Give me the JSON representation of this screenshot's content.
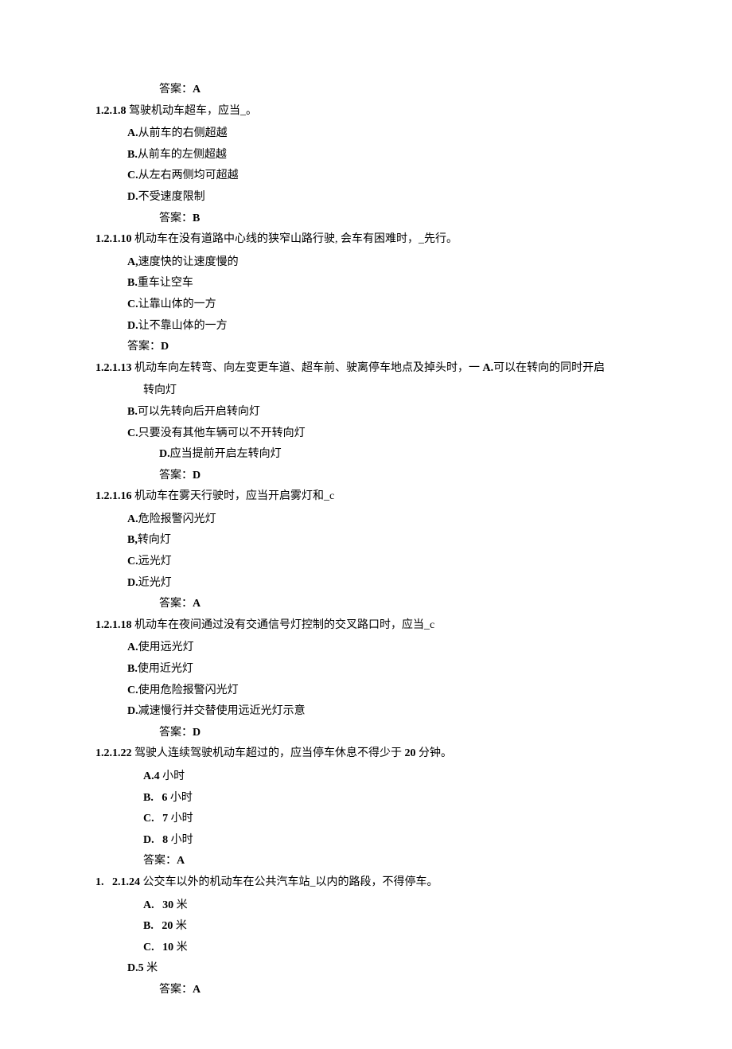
{
  "q0": {
    "answer_label": "答案：",
    "answer": "A"
  },
  "q1": {
    "number": "1.2.1.8",
    "text": " 驾驶机动车超车，应当_。",
    "opts": {
      "A": "从前车的右侧超越",
      "B": "从前车的左侧超越",
      "C": "从左右两侧均可超越",
      "D": "不受速度限制"
    },
    "answer_label": "答案：",
    "answer": "B"
  },
  "q2": {
    "number": "1.2.1.10",
    "text": " 机动车在没有道路中心线的狭窄山路行驶, 会车有困难时，_先行。",
    "opts": {
      "A": "速度快的让速度慢的",
      "B": "重车让空车",
      "C": "让靠山体的一方",
      "D": "让不靠山体的一方"
    },
    "answer_label": "答案：",
    "answer": "D"
  },
  "q3": {
    "number": "1.2.1.13",
    "text": " 机动车向左转弯、向左变更车道、超车前、驶离停车地点及掉头时，一 ",
    "optA_inline": "可以在转向的同时开启",
    "cont": "转向灯",
    "opts": {
      "B": "可以先转向后开启转向灯",
      "C": "只要没有其他车辆可以不开转向灯",
      "D": "应当提前开启左转向灯"
    },
    "answer_label": "答案：",
    "answer": "D"
  },
  "q4": {
    "number": "1.2.1.16",
    "text": " 机动车在雾天行驶时，应当开启雾灯和_c",
    "opts": {
      "A": "危险报警闪光灯",
      "B": "转向灯",
      "C": "远光灯",
      "D": "近光灯"
    },
    "answer_label": "答案：",
    "answer": "A"
  },
  "q5": {
    "number": "1.2.1.18",
    "text": " 机动车在夜间通过没有交通信号灯控制的交叉路口时，应当_c",
    "opts": {
      "A": "使用远光灯",
      "B": "使用近光灯",
      "C": "使用危险报警闪光灯",
      "D": "减速慢行并交替使用远近光灯示意"
    },
    "answer_label": "答案：",
    "answer": "D"
  },
  "q6": {
    "number": "1.2.1.22",
    "text": " 驾驶人连续驾驶机动车超过的，应当停车休息不得少于 ",
    "tail": " 分钟。",
    "tail_num": "20",
    "opts": {
      "A": "4",
      "A_suffix": " 小时",
      "B": "6",
      "B_suffix": " 小时",
      "C": "7",
      "C_suffix": " 小时",
      "D": "8",
      "D_suffix": " 小时"
    },
    "answer_label": "答案：",
    "answer": "A"
  },
  "q7": {
    "number_prefix": "1.",
    "number": "2.1.24",
    "text": " 公交车以外的机动车在公共汽车站_以内的路段，不得停车。",
    "opts": {
      "A": "30",
      "A_suffix": " 米",
      "B": "20",
      "B_suffix": " 米",
      "C": "10",
      "C_suffix": " 米",
      "D": "5",
      "D_suffix": " 米"
    },
    "answer_label": "答案：",
    "answer": "A"
  }
}
